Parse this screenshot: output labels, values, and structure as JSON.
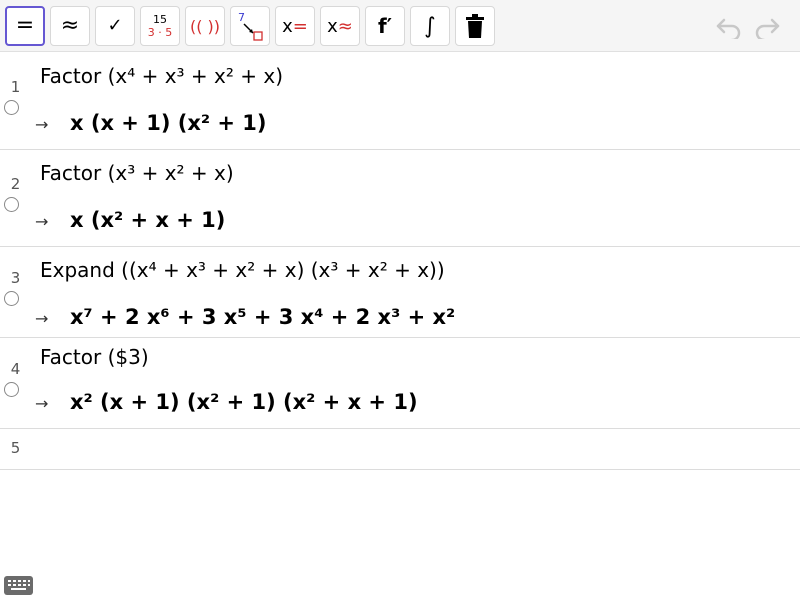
{
  "toolbar": {
    "buttons": [
      {
        "name": "evaluate",
        "glyph": "="
      },
      {
        "name": "numeric",
        "glyph": "≈"
      },
      {
        "name": "keep-input",
        "glyph": "✓"
      },
      {
        "name": "factor-number",
        "top": "15",
        "bottom": "3 · 5"
      },
      {
        "name": "expand",
        "glyph": "(( ))"
      },
      {
        "name": "substitute",
        "top": "7"
      },
      {
        "name": "solve",
        "glyph_x": "x",
        "glyph_op": "="
      },
      {
        "name": "solve-numerically",
        "glyph_x": "x",
        "glyph_op": "≈"
      },
      {
        "name": "derivative",
        "glyph": "f′"
      },
      {
        "name": "integral",
        "glyph": "∫"
      },
      {
        "name": "delete",
        "glyph": "🗑"
      }
    ]
  },
  "rows": [
    {
      "number": "1",
      "input": "Factor (x⁴ + x³ + x² + x)",
      "output": "x  (x + 1)  (x² + 1)"
    },
    {
      "number": "2",
      "input": "Factor (x³ + x² + x)",
      "output": "x  (x² + x + 1)"
    },
    {
      "number": "3",
      "input": "Expand ((x⁴ + x³ + x² + x)  (x³ + x² + x))",
      "output": "x⁷ + 2 x⁶ + 3 x⁵ + 3 x⁴ + 2 x³ + x²"
    },
    {
      "number": "4",
      "input": "Factor ($3)",
      "output": "x²  (x + 1)  (x² + 1)  (x² + x + 1)"
    },
    {
      "number": "5",
      "input": "",
      "output": ""
    }
  ],
  "output_arrow": "→",
  "colors": {
    "accent": "#6557d2",
    "red": "#d32f2f"
  }
}
